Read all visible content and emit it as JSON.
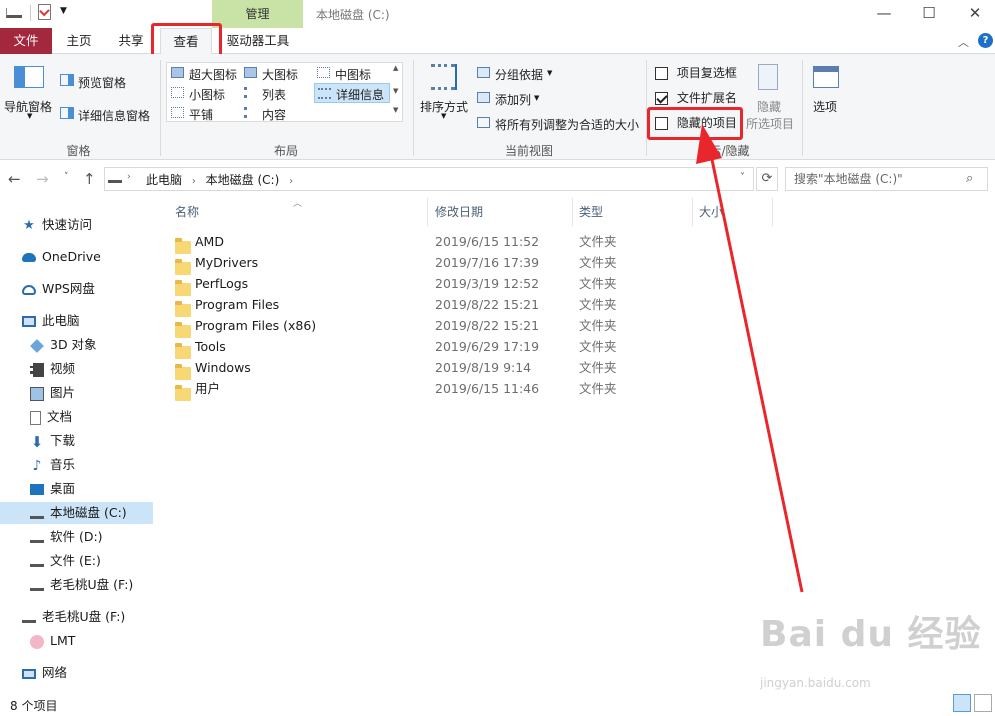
{
  "titlebar": {
    "manage_tab": "管理",
    "title": "本地磁盘 (C:)",
    "minimize": "—",
    "maximize": "☐",
    "close": "✕"
  },
  "tabs": [
    {
      "label": "文件"
    },
    {
      "label": "主页"
    },
    {
      "label": "共享"
    },
    {
      "label": "查看"
    },
    {
      "label": "驱动器工具"
    }
  ],
  "ribbon": {
    "panes": {
      "label": "窗格",
      "nav_pane": "导航窗格",
      "preview_pane": "预览窗格",
      "details_pane": "详细信息窗格"
    },
    "layout": {
      "label": "布局",
      "options": [
        "超大图标",
        "大图标",
        "中图标",
        "小图标",
        "列表",
        "详细信息",
        "平铺",
        "内容"
      ]
    },
    "current_view": {
      "label": "当前视图",
      "sort_by": "排序方式",
      "group_by": "分组依据",
      "add_columns": "添加列",
      "fit_columns": "将所有列调整为合适的大小"
    },
    "show_hide": {
      "label": "显示/隐藏",
      "item_checkboxes": "项目复选框",
      "file_extensions": "文件扩展名",
      "hidden_items": "隐藏的项目",
      "hide_selected_1": "隐藏",
      "hide_selected_2": "所选项目"
    },
    "options": "选项"
  },
  "address": {
    "crumbs": [
      "此电脑",
      "本地磁盘 (C:)"
    ],
    "search_placeholder": "搜索\"本地磁盘 (C:)\""
  },
  "nav": {
    "items": [
      {
        "label": "快速访问",
        "icon": "star-icon"
      },
      {
        "label": "OneDrive",
        "icon": "cloud-icon"
      },
      {
        "label": "WPS网盘",
        "icon": "cloud-icon"
      },
      {
        "label": "此电脑",
        "icon": "computer-icon"
      },
      {
        "label": "3D 对象",
        "icon": "cube-icon"
      },
      {
        "label": "视频",
        "icon": "video-icon"
      },
      {
        "label": "图片",
        "icon": "picture-icon"
      },
      {
        "label": "文档",
        "icon": "document-icon"
      },
      {
        "label": "下载",
        "icon": "download-icon"
      },
      {
        "label": "音乐",
        "icon": "music-icon"
      },
      {
        "label": "桌面",
        "icon": "desktop-icon"
      },
      {
        "label": "本地磁盘 (C:)",
        "icon": "drive-icon"
      },
      {
        "label": "软件 (D:)",
        "icon": "drive-icon"
      },
      {
        "label": "文件 (E:)",
        "icon": "drive-icon"
      },
      {
        "label": "老毛桃U盘 (F:)",
        "icon": "usb-drive-icon"
      },
      {
        "label": "老毛桃U盘 (F:)",
        "icon": "usb-drive-icon"
      },
      {
        "label": "LMT",
        "icon": "lmt-icon"
      },
      {
        "label": "网络",
        "icon": "network-icon"
      }
    ]
  },
  "columns": {
    "name": "名称",
    "date": "修改日期",
    "type": "类型",
    "size": "大小"
  },
  "files": [
    {
      "name": "AMD",
      "date": "2019/6/15 11:52",
      "type": "文件夹"
    },
    {
      "name": "MyDrivers",
      "date": "2019/7/16 17:39",
      "type": "文件夹"
    },
    {
      "name": "PerfLogs",
      "date": "2019/3/19 12:52",
      "type": "文件夹"
    },
    {
      "name": "Program Files",
      "date": "2019/8/22 15:21",
      "type": "文件夹"
    },
    {
      "name": "Program Files (x86)",
      "date": "2019/8/22 15:21",
      "type": "文件夹"
    },
    {
      "name": "Tools",
      "date": "2019/6/29 17:19",
      "type": "文件夹"
    },
    {
      "name": "Windows",
      "date": "2019/8/19 9:14",
      "type": "文件夹"
    },
    {
      "name": "用户",
      "date": "2019/6/15 11:46",
      "type": "文件夹"
    }
  ],
  "status": {
    "count": "8 个项目"
  },
  "watermark": {
    "main": "Bai du 经验",
    "sub": "jingyan.baidu.com"
  },
  "colors": {
    "file_tab": "#a3283e",
    "manage_tab": "#c9e3a7",
    "highlight": "#e8262b",
    "selected_nav": "#cce4f7"
  }
}
